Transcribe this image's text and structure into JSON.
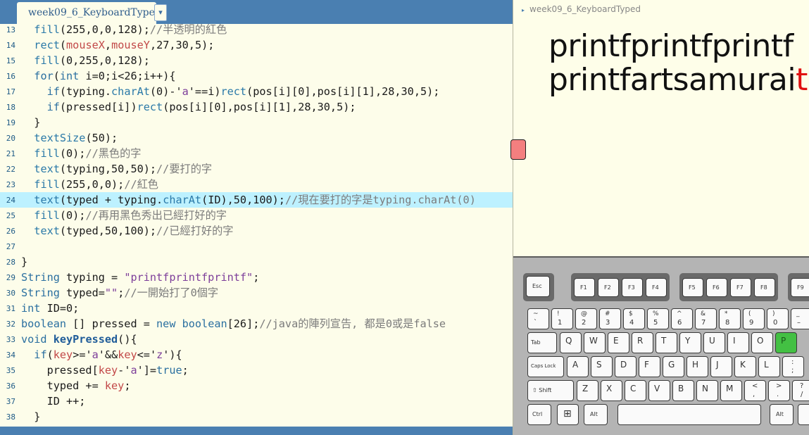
{
  "editor": {
    "tab_title": "week09_6_KeyboardTyped",
    "tab_menu_glyph": "▾",
    "highlighted_line": 24,
    "lines": [
      {
        "n": "13",
        "segs": [
          [
            "  ",
            ""
          ],
          [
            "fill",
            "fn"
          ],
          [
            "(255,0,0,128);",
            ""
          ],
          [
            "//半透明的紅色",
            "cm"
          ]
        ]
      },
      {
        "n": "14",
        "segs": [
          [
            "  ",
            ""
          ],
          [
            "rect",
            "fn"
          ],
          [
            "(",
            ""
          ],
          [
            "mouseX",
            "var"
          ],
          [
            ",",
            ""
          ],
          [
            "mouseY",
            "var"
          ],
          [
            ",27,30,5);",
            ""
          ]
        ]
      },
      {
        "n": "15",
        "segs": [
          [
            "  ",
            ""
          ],
          [
            "fill",
            "fn"
          ],
          [
            "(0,255,0,128);",
            ""
          ]
        ]
      },
      {
        "n": "16",
        "segs": [
          [
            "  ",
            ""
          ],
          [
            "for",
            "kw"
          ],
          [
            "(",
            ""
          ],
          [
            "int",
            "kw"
          ],
          [
            " i=0;i<26;i++){",
            ""
          ]
        ]
      },
      {
        "n": "17",
        "segs": [
          [
            "    ",
            ""
          ],
          [
            "if",
            "kw"
          ],
          [
            "(typing.",
            ""
          ],
          [
            "charAt",
            "fn"
          ],
          [
            "(0)-'",
            ""
          ],
          [
            "a",
            "str"
          ],
          [
            "'==i)",
            ""
          ],
          [
            "rect",
            "fn"
          ],
          [
            "(pos[i][0],pos[i][1],28,30,5);",
            ""
          ]
        ]
      },
      {
        "n": "18",
        "segs": [
          [
            "    ",
            ""
          ],
          [
            "if",
            "kw"
          ],
          [
            "(pressed[i])",
            ""
          ],
          [
            "rect",
            "fn"
          ],
          [
            "(pos[i][0],pos[i][1],28,30,5);",
            ""
          ]
        ]
      },
      {
        "n": "19",
        "segs": [
          [
            "  }",
            ""
          ]
        ]
      },
      {
        "n": "20",
        "segs": [
          [
            "  ",
            ""
          ],
          [
            "textSize",
            "fn"
          ],
          [
            "(50);",
            ""
          ]
        ]
      },
      {
        "n": "21",
        "segs": [
          [
            "  ",
            ""
          ],
          [
            "fill",
            "fn"
          ],
          [
            "(0);",
            ""
          ],
          [
            "//黑色的字",
            "cm"
          ]
        ]
      },
      {
        "n": "22",
        "segs": [
          [
            "  ",
            ""
          ],
          [
            "text",
            "fn"
          ],
          [
            "(typing,50,50);",
            ""
          ],
          [
            "//要打的字",
            "cm"
          ]
        ]
      },
      {
        "n": "23",
        "segs": [
          [
            "  ",
            ""
          ],
          [
            "fill",
            "fn"
          ],
          [
            "(255,0,0);",
            ""
          ],
          [
            "//紅色",
            "cm"
          ]
        ]
      },
      {
        "n": "24",
        "segs": [
          [
            "  ",
            ""
          ],
          [
            "text",
            "fn"
          ],
          [
            "(typed + typing.",
            ""
          ],
          [
            "charAt",
            "fn"
          ],
          [
            "(ID),50,100);",
            ""
          ],
          [
            "//現在要打的字是typing.charAt(0)",
            "cm"
          ]
        ]
      },
      {
        "n": "25",
        "segs": [
          [
            "  ",
            ""
          ],
          [
            "fill",
            "fn"
          ],
          [
            "(0);",
            ""
          ],
          [
            "//再用黑色秀出已經打好的字",
            "cm"
          ]
        ]
      },
      {
        "n": "26",
        "segs": [
          [
            "  ",
            ""
          ],
          [
            "text",
            "fn"
          ],
          [
            "(typed,50,100);",
            ""
          ],
          [
            "//已經打好的字",
            "cm"
          ]
        ]
      },
      {
        "n": "27",
        "segs": []
      },
      {
        "n": "28",
        "segs": [
          [
            "}",
            ""
          ]
        ]
      },
      {
        "n": "29",
        "segs": [
          [
            "String",
            "kw"
          ],
          [
            " typing = ",
            ""
          ],
          [
            "\"printfprintfprintf\"",
            "str"
          ],
          [
            ";",
            ""
          ]
        ]
      },
      {
        "n": "30",
        "segs": [
          [
            "String",
            "kw"
          ],
          [
            " typed=",
            ""
          ],
          [
            "\"\"",
            "str"
          ],
          [
            ";",
            ""
          ],
          [
            "//一開始打了0個字",
            "cm"
          ]
        ]
      },
      {
        "n": "31",
        "segs": [
          [
            "int",
            "kw"
          ],
          [
            " ID=0;",
            ""
          ]
        ]
      },
      {
        "n": "32",
        "segs": [
          [
            "boolean",
            "kw"
          ],
          [
            " [] pressed = ",
            ""
          ],
          [
            "new",
            "kw"
          ],
          [
            " ",
            ""
          ],
          [
            "boolean",
            "kw"
          ],
          [
            "[26];",
            ""
          ],
          [
            "//java的陣列宣告, 都是0或是false",
            "cm"
          ]
        ]
      },
      {
        "n": "33",
        "segs": [
          [
            "void",
            "kw"
          ],
          [
            " ",
            ""
          ],
          [
            "keyPressed",
            "bold"
          ],
          [
            "(){",
            ""
          ]
        ]
      },
      {
        "n": "34",
        "segs": [
          [
            "  ",
            ""
          ],
          [
            "if",
            "kw"
          ],
          [
            "(",
            ""
          ],
          [
            "key",
            "var"
          ],
          [
            ">='",
            ""
          ],
          [
            "a",
            "str"
          ],
          [
            "'&&",
            ""
          ],
          [
            "key",
            "var"
          ],
          [
            "<='",
            ""
          ],
          [
            "z",
            "str"
          ],
          [
            "'){",
            ""
          ]
        ]
      },
      {
        "n": "35",
        "segs": [
          [
            "    pressed[",
            ""
          ],
          [
            "key",
            "var"
          ],
          [
            "-'",
            ""
          ],
          [
            "a",
            "str"
          ],
          [
            "']=",
            ""
          ],
          [
            "true",
            "kw"
          ],
          [
            ";",
            ""
          ]
        ]
      },
      {
        "n": "36",
        "segs": [
          [
            "    typed += ",
            ""
          ],
          [
            "key",
            "var"
          ],
          [
            ";",
            ""
          ]
        ]
      },
      {
        "n": "37",
        "segs": [
          [
            "    ID ++;",
            ""
          ]
        ]
      },
      {
        "n": "38",
        "segs": [
          [
            "  }",
            ""
          ]
        ]
      }
    ]
  },
  "sketch": {
    "window_title": "week09_6_KeyboardTyped",
    "title_arrow": "▸",
    "typing_text": "printfprintfprintf",
    "typed_text": "printfartsamurai",
    "current_char": "t",
    "current_char_color": "#e01010"
  },
  "keyboard": {
    "esc": "Esc",
    "f_keys": [
      "F1",
      "F2",
      "F3",
      "F4",
      "F5",
      "F6",
      "F7",
      "F8",
      "F9"
    ],
    "num_row": [
      [
        "~",
        "`"
      ],
      [
        "!",
        "1"
      ],
      [
        "@",
        "2"
      ],
      [
        "#",
        "3"
      ],
      [
        "$",
        "4"
      ],
      [
        "%",
        "5"
      ],
      [
        "^",
        "6"
      ],
      [
        "&",
        "7"
      ],
      [
        "*",
        "8"
      ],
      [
        "(",
        "9"
      ],
      [
        ")",
        "0"
      ],
      [
        "_",
        "–"
      ]
    ],
    "qwerty": [
      "Q",
      "W",
      "E",
      "R",
      "T",
      "Y",
      "U",
      "I",
      "O",
      "P"
    ],
    "asdf": [
      "A",
      "S",
      "D",
      "F",
      "G",
      "H",
      "J",
      "K",
      "L"
    ],
    "semicolon": [
      ":",
      ";"
    ],
    "zxcv": [
      "Z",
      "X",
      "C",
      "V",
      "B",
      "N",
      "M"
    ],
    "comma": [
      "<",
      ","
    ],
    "period": [
      ">",
      "."
    ],
    "slash": [
      "?",
      "/"
    ],
    "tab": "Tab",
    "caps": "Caps Lock",
    "shift": "⇧ Shift",
    "ctrl": "Ctrl",
    "alt_left": "Alt",
    "alt_right": "Alt",
    "win_glyph": "⊞",
    "pressed_key": "P",
    "pressed_color": "#43c043"
  }
}
